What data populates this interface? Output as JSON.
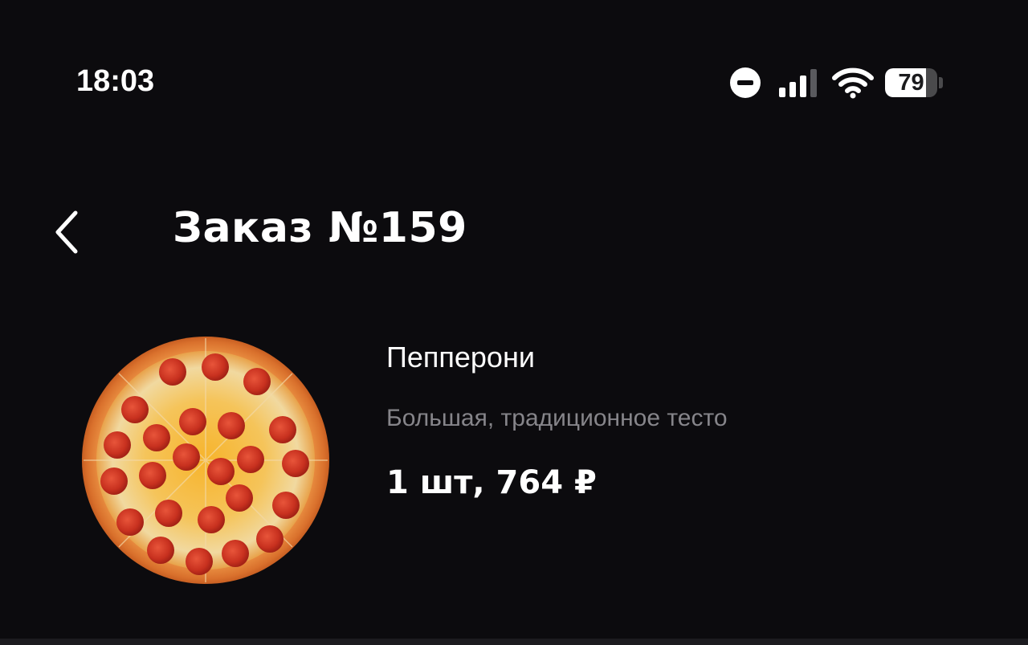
{
  "status_bar": {
    "time": "18:03",
    "battery_level": "79",
    "battery_fraction": 0.79,
    "icons": [
      "do-not-disturb-icon",
      "cellular-signal-icon",
      "wifi-icon",
      "battery-icon"
    ]
  },
  "header": {
    "back_icon": "chevron-left-icon",
    "title": "Заказ №159"
  },
  "order": {
    "items": [
      {
        "image": "pepperoni-pizza-image",
        "name": "Пепперони",
        "description": "Большая, традиционное тесто",
        "quantity_price": "1 шт, 764 ₽"
      }
    ]
  },
  "colors": {
    "background": "#0c0b0e",
    "text_primary": "#ffffff",
    "text_secondary": "#86858a"
  }
}
